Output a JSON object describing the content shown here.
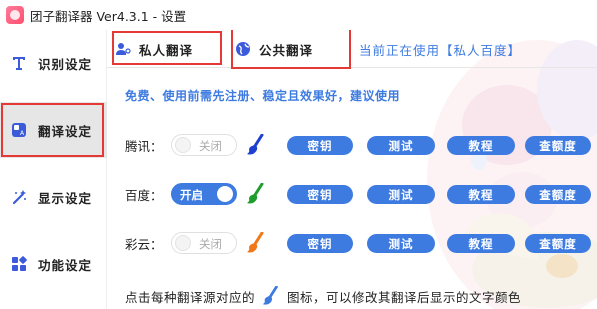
{
  "app": {
    "title": "团子翻译器 Ver4.3.1 - 设置"
  },
  "sidebar": {
    "items": [
      {
        "id": "ocr",
        "label": "识别设定",
        "icon": "text-t-icon"
      },
      {
        "id": "translate",
        "label": "翻译设定",
        "icon": "translate-icon",
        "active": true
      },
      {
        "id": "display",
        "label": "显示设定",
        "icon": "magic-wand-icon"
      },
      {
        "id": "features",
        "label": "功能设定",
        "icon": "grid-icon"
      }
    ]
  },
  "tabs": [
    {
      "id": "private",
      "label": "私人翻译",
      "icon": "user-key-icon"
    },
    {
      "id": "public",
      "label": "公共翻译",
      "icon": "globe-icon"
    }
  ],
  "current_use": "当前正在使用【私人百度】",
  "notice": "免费、使用前需先注册、稳定且效果好，建议使用",
  "rows": [
    {
      "name": "tencent",
      "label": "腾讯：",
      "state": "关闭",
      "enabled": false,
      "brush_color": "#1f3fd1",
      "key_label": "密钥",
      "test_label": "测试",
      "tutorial_label": "教程",
      "quota_label": "查额度"
    },
    {
      "name": "baidu",
      "label": "百度：",
      "state": "开启",
      "enabled": true,
      "brush_color": "#1f9e2e",
      "key_label": "密钥",
      "test_label": "测试",
      "tutorial_label": "教程",
      "quota_label": "查额度"
    },
    {
      "name": "caiyun",
      "label": "彩云：",
      "state": "关闭",
      "enabled": false,
      "brush_color": "#f07818",
      "key_label": "密钥",
      "test_label": "测试",
      "tutorial_label": "教程",
      "quota_label": "查额度"
    }
  ],
  "bottom_tip": {
    "before": "点击每种翻译源对应的",
    "after": "图标，可以修改其翻译后显示的文字颜色"
  },
  "colors": {
    "accent": "#3d7be0",
    "highlight_box": "#e53935"
  }
}
